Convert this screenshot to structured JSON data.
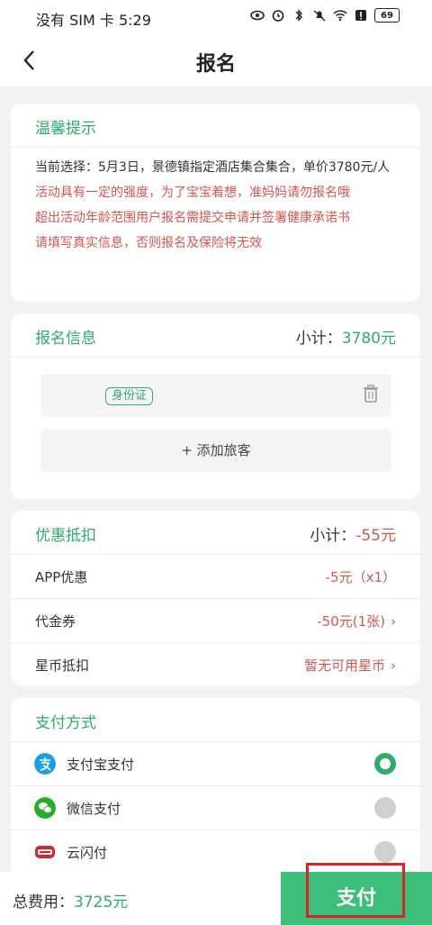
{
  "status": {
    "left": "没有 SIM 卡 5:29",
    "battery": "69"
  },
  "nav": {
    "title": "报名"
  },
  "tip": {
    "title": "温馨提示",
    "selection": "当前选择：5月3日，景德镇指定酒店集合集合，单价3780元/人",
    "warn1": "活动具有一定的强度，为了宝宝着想，准妈妈请勿报名哦",
    "warn2": "超出活动年龄范围用户报名需提交申请并签署健康承诺书",
    "warn3": "请填写真实信息，否则报名及保险将无效"
  },
  "signup": {
    "title": "报名信息",
    "subtotal_label": "小计：",
    "subtotal_value": "3780元",
    "id_tag": "身份证",
    "add_label": "+ 添加旅客"
  },
  "discount": {
    "title": "优惠抵扣",
    "subtotal_label": "小计：",
    "subtotal_value": "-55元",
    "rows": [
      {
        "label": "APP优惠",
        "value": "-5元（x1）",
        "chevron": ""
      },
      {
        "label": "代金券",
        "value": "-50元(1张)",
        "chevron": "›"
      },
      {
        "label": "星币抵扣",
        "value": "暂无可用星币",
        "chevron": "›"
      }
    ]
  },
  "payment": {
    "title": "支付方式",
    "methods": [
      {
        "label": "支付宝支付",
        "selected": true
      },
      {
        "label": "微信支付",
        "selected": false
      },
      {
        "label": "云闪付",
        "selected": false
      }
    ]
  },
  "footer": {
    "total_label": "总费用：",
    "total_value": "3725元",
    "pay_label": "支付"
  }
}
